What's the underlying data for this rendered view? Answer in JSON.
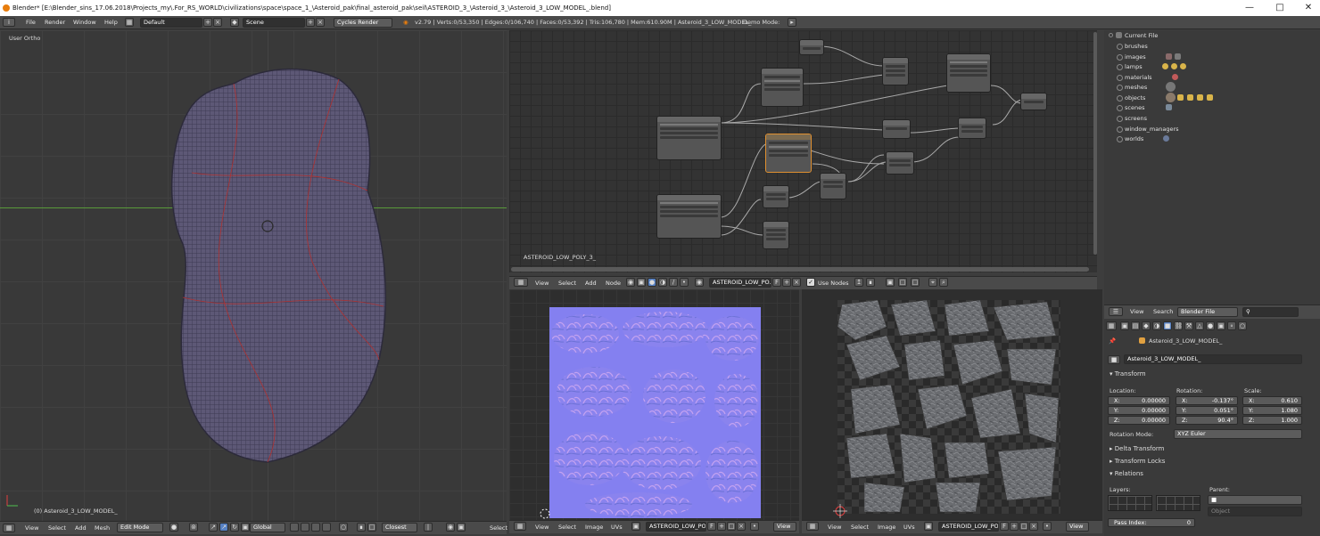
{
  "window": {
    "title": "Blender* [E:\\Blender_sins_17.06.2018\\Projects_my\\.For_RS_WORLD\\civilizations\\space\\space_1_\\Asteroid_pak\\final_asteroid_pak\\seil\\ASTEROID_3_\\Asteroid_3_\\Asteroid_3_LOW_MODEL_.blend]"
  },
  "info_header": {
    "menus": [
      "File",
      "Render",
      "Window",
      "Help"
    ],
    "layout": "Default",
    "scene": "Scene",
    "engine": "Cycles Render",
    "stats": "v2.79 | Verts:0/53,350 | Edges:0/106,740 | Faces:0/53,392 | Tris:106,780 | Mem:610.90M | Asteroid_3_LOW_MODEL_",
    "demo_mode": "Demo Mode:"
  },
  "viewport": {
    "view_label": "User Ortho",
    "object_label": "(0) Asteroid_3_LOW_MODEL_",
    "menus": [
      "View",
      "Select",
      "Add",
      "Mesh"
    ],
    "mode": "Edit Mode",
    "orientation": "Global",
    "snap": "Closest",
    "extra_menu": "Select"
  },
  "node_editor": {
    "material_label": "ASTEROID_LOW_POLY_3_",
    "menus": [
      "View",
      "Select",
      "Add",
      "Node"
    ],
    "material_field": "ASTEROID_LOW_PO...",
    "fake_user": "F",
    "use_nodes": "Use Nodes"
  },
  "image_editor_left": {
    "menus": [
      "View",
      "Select",
      "Image",
      "UVs"
    ],
    "image_field": "ASTEROID_LOW_PO...",
    "fake_user": "F",
    "view": "View"
  },
  "image_editor_right": {
    "menus": [
      "View",
      "Select",
      "Image",
      "UVs"
    ],
    "image_field": "ASTEROID_LOW_PO...",
    "fake_user": "F",
    "view": "View"
  },
  "outliner": {
    "root": "Current File",
    "items": [
      "brushes",
      "images",
      "lamps",
      "materials",
      "meshes",
      "objects",
      "scenes",
      "screens",
      "window_managers",
      "worlds"
    ],
    "menus": [
      "View",
      "Search"
    ],
    "display_mode": "Blender File"
  },
  "properties": {
    "breadcrumb": "Asteroid_3_LOW_MODEL_",
    "object_name": "Asteroid_3_LOW_MODEL_",
    "transform_label": "Transform",
    "location_label": "Location:",
    "rotation_label": "Rotation:",
    "scale_label": "Scale:",
    "location": [
      {
        "k": "X:",
        "v": "0.00000"
      },
      {
        "k": "Y:",
        "v": "0.00000"
      },
      {
        "k": "Z:",
        "v": "0.00000"
      }
    ],
    "rotation": [
      {
        "k": "X:",
        "v": "-0.137°"
      },
      {
        "k": "Y:",
        "v": "0.051°"
      },
      {
        "k": "Z:",
        "v": "90.4°"
      }
    ],
    "scale": [
      {
        "k": "X:",
        "v": "0.610"
      },
      {
        "k": "Y:",
        "v": "1.080"
      },
      {
        "k": "Z:",
        "v": "1.000"
      }
    ],
    "rotation_mode_label": "Rotation Mode:",
    "rotation_mode": "XYZ Euler",
    "delta_transform": "Delta Transform",
    "transform_locks": "Transform Locks",
    "relations": "Relations",
    "layers_label": "Layers:",
    "parent_label": "Parent:",
    "parent_type": "Object",
    "pass_index_label": "Pass Index:",
    "pass_index": "0"
  }
}
